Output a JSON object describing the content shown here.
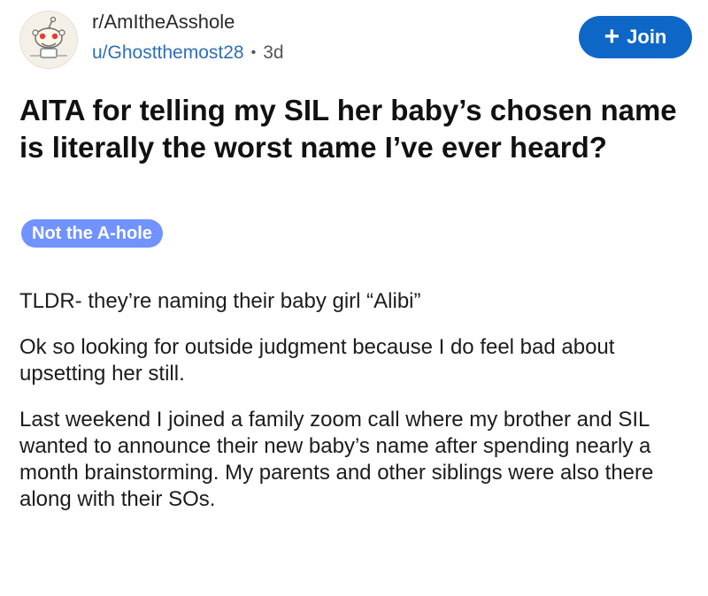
{
  "header": {
    "subreddit": "r/AmItheAsshole",
    "username": "u/Ghostthemost28",
    "separator": "•",
    "age": "3d",
    "join_label": "Join",
    "join_icon": "+"
  },
  "post": {
    "title": "AITA for telling my SIL her baby’s chosen name is literally the worst name I’ve ever heard?",
    "flair": "Not the A-hole",
    "paragraphs": [
      "TLDR- they’re naming their baby girl “Alibi”",
      "Ok so looking for outside judgment because I do feel bad about upsetting her still.",
      "Last weekend I joined a family zoom call where my brother and SIL wanted to announce their new baby’s name after spending nearly a month brainstorming. My parents and other siblings were also there along with their SOs."
    ]
  },
  "colors": {
    "join_button": "#0e66c6",
    "flair_bg": "#7193ff",
    "username": "#2f6fb3",
    "text": "#1c1c1c"
  },
  "icons": {
    "avatar": "subreddit-avatar-icon",
    "join": "plus-icon"
  }
}
